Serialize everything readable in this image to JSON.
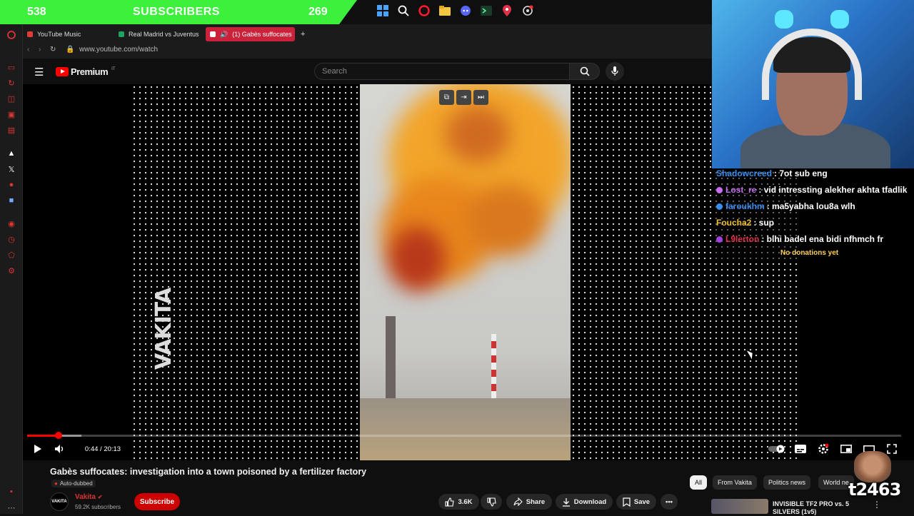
{
  "overlay": {
    "sub_goal_left": "538",
    "sub_goal_title": "SUBSCRIBERS",
    "sub_goal_right": "269",
    "bar_color": "#3cf03c",
    "streamer_tag": "t2463"
  },
  "taskbar": {
    "icons": [
      "windows-start-icon",
      "search-icon",
      "opera-icon",
      "file-explorer-icon",
      "discord-icon",
      "terminal-icon",
      "maps-pin-icon",
      "settings-icon"
    ]
  },
  "browser": {
    "tabs": [
      {
        "label": "YouTube Music",
        "color": "#e03c3c"
      },
      {
        "label": "Real Madrid vs Juventus",
        "color": "#1fa463"
      },
      {
        "label": "(1) Gabès suffocates",
        "color": "#ff3b3b"
      }
    ],
    "new_tab": "+",
    "url": "www.youtube.com/watch"
  },
  "youtube": {
    "logo_word": "Premium",
    "logo_country": "IT",
    "search_placeholder": "Search",
    "player": {
      "watermark": "VAKITA",
      "time": "0:44 / 20:13",
      "progress": 0.036,
      "buffered": 0.062
    },
    "video": {
      "title": "Gabès suffocates: investigation into a town poisoned by a fertilizer factory",
      "auto_dubbed": "Auto-dubbed",
      "channel_avatar_text": "VAKITA",
      "channel_name": "Vakita",
      "channel_subs": "59.2K subscribers",
      "subscribe": "Subscribe",
      "likes": "3.6K",
      "share": "Share",
      "download": "Download",
      "save": "Save"
    },
    "chips": [
      "All",
      "From Vakita",
      "Politics news",
      "World ne"
    ],
    "recommendation": {
      "title": "INVISIBLE TF2 PRO vs. 5 SILVERS (1v5)"
    }
  },
  "chat": {
    "lines": [
      {
        "user": "Shadowcreed",
        "msg": ": 7ot sub eng",
        "color": "#3a8ef0"
      },
      {
        "user": "Lost_re",
        "msg": ": vid intressting alekher akhta tfadlik",
        "color": "#c86df0"
      },
      {
        "user": "faroukhm",
        "msg": ": ma5yabha lou8a wlh",
        "color": "#3a8ef0"
      },
      {
        "user": "Foucha2",
        "msg": ": sup",
        "color": "#f0c030"
      },
      {
        "user": "L9lerton",
        "msg": ": blhi badel ena bidi nfhmch fr",
        "color": "#e0304a"
      }
    ],
    "no_donations": "No donations yet"
  }
}
